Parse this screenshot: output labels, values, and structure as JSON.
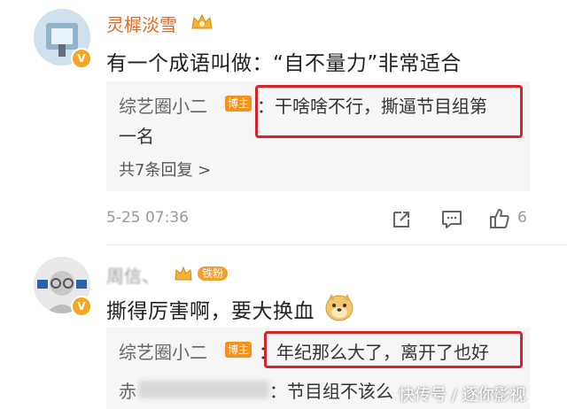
{
  "comment1": {
    "username": "灵樨淡雪",
    "text": "有一个成语叫做：“自不量力”非常适合",
    "reply": {
      "name": "综艺圈小二",
      "badge": "博主",
      "text_line1": "：干啥啥不行，撕逼节目组第",
      "text_line2": "一名",
      "more": "共7条回复 >"
    },
    "time": "5-25 07:36",
    "likes": "6"
  },
  "comment2": {
    "username": "周信、",
    "fan_badge": "铁粉",
    "text": "撕得厉害啊，要大换血",
    "reply": {
      "name": "综艺圈小二",
      "badge": "博主",
      "text": "：年纪那么大了，离开了也好"
    },
    "reply2": {
      "name_prefix": "赤",
      "text": "：节目组不该么"
    }
  },
  "watermark": "快传号 / 逐你影视",
  "colors": {
    "username": "#e06a2a",
    "highlight": "#d6252a",
    "badge": "#f3921f"
  }
}
